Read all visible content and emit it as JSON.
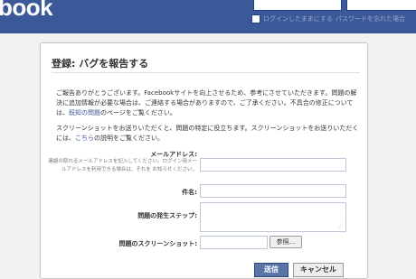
{
  "header": {
    "logo_text": "book",
    "remember_me_label": "ログインしたままにする",
    "forgot_password_label": "パスワードを忘れた場合"
  },
  "dialog": {
    "title": "登録: バグを報告する",
    "intro_paragraph_1_a": "ご報告ありがとうございます。Facebookサイトを向上させるため、参考にさせていただきます。問題の解決に追加情報が必要な場合は、ご連絡する場合がありますので、ご了承ください。不具合の修正については、",
    "intro_paragraph_1_link": "既知の問題",
    "intro_paragraph_1_b": "のページをご覧ください。",
    "intro_paragraph_2_a": "スクリーンショットをお送りいただくと、問題の特定に役立ちます。スクリーンショットをお送りいただくには、",
    "intro_paragraph_2_link": "こちら",
    "intro_paragraph_2_b": "の説明をご覧ください。",
    "email_label": "メールアドレス:",
    "email_hint": "連絡の取れるメールアドレスを記入してください。ログイン用メールアドレスを利用できる場合は、それを お知らせください。",
    "email_value": "",
    "subject_label": "件名:",
    "subject_value": "",
    "steps_label": "問題の発生ステップ:",
    "steps_value": "",
    "screenshot_label": "問題のスクリーンショット:",
    "screenshot_value": "",
    "browse_button": "参照...",
    "send_button": "送信",
    "cancel_button": "キャンセル"
  }
}
